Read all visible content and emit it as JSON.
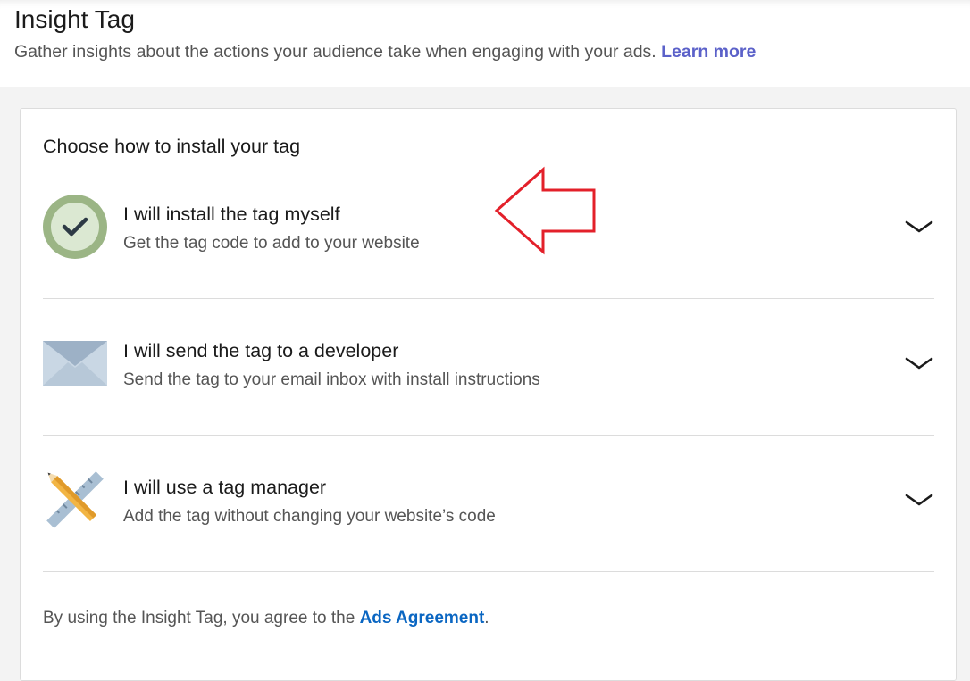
{
  "header": {
    "title": "Insight Tag",
    "subtitle": "Gather insights about the actions your audience take when engaging with your ads.",
    "learn_more": "Learn more"
  },
  "card": {
    "heading": "Choose how to install your tag",
    "options": [
      {
        "title": "I will install the tag myself",
        "description": "Get the tag code to add to your website",
        "icon": "checkmark-circle-icon"
      },
      {
        "title": "I will send the tag to a developer",
        "description": "Send the tag to your email inbox with install instructions",
        "icon": "envelope-icon"
      },
      {
        "title": "I will use a tag manager",
        "description": "Add the tag without changing your website’s code",
        "icon": "pencil-ruler-icon"
      }
    ],
    "footer": {
      "prefix": "By using the Insight Tag, you agree to the ",
      "link": "Ads Agreement",
      "suffix": "."
    }
  },
  "colors": {
    "link_purple": "#5b61c9",
    "link_blue": "#0a66c2",
    "check_green": "#9bb585",
    "annotation_red": "#e3202a"
  }
}
